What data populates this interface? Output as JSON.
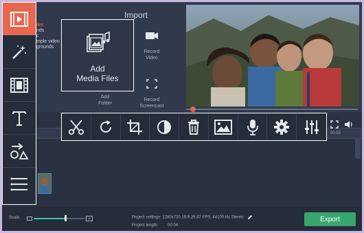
{
  "left_tools": [
    {
      "icon": "film-import-icon",
      "active": true
    },
    {
      "icon": "magic-wand-icon"
    },
    {
      "icon": "film-frames-icon"
    },
    {
      "icon": "text-T-icon"
    },
    {
      "icon": "shapes-arrow-icon"
    },
    {
      "icon": "list-lines-icon"
    }
  ],
  "import": {
    "title": "Import",
    "list_items": [
      "iles",
      "nds",
      "c",
      "mple video",
      "grounds"
    ],
    "add_media_label_line1": "Add",
    "add_media_label_line2": "Media Files",
    "record_video_line1": "Record",
    "record_video_line2": "Video",
    "add_folder_line1": "Add",
    "add_folder_line2": "Folder",
    "record_screencast_line1": "Record",
    "record_screencast_line2": "Screencast"
  },
  "toolbar": {
    "tools": [
      "scissors-icon",
      "rotate-icon",
      "crop-icon",
      "color-adjust-icon",
      "trash-icon",
      "image-icon",
      "microphone-icon",
      "gear-icon",
      "equalizer-icon"
    ]
  },
  "timeline": {
    "ruler_label": "00:55"
  },
  "bottom": {
    "scale_label": "Scale:",
    "project_settings": "Project settings:  1280x720 16:9 29.97 FPS, 44100 Hz Stereo",
    "project_length_label": "Project length:",
    "project_length_value": "00:04",
    "export_label": "Export",
    "scale_value": 0.62
  },
  "colors": {
    "accent": "#e8674f",
    "export_green": "#3aa66f",
    "slider_teal": "#3ec9a2",
    "background": "#2b3344"
  }
}
